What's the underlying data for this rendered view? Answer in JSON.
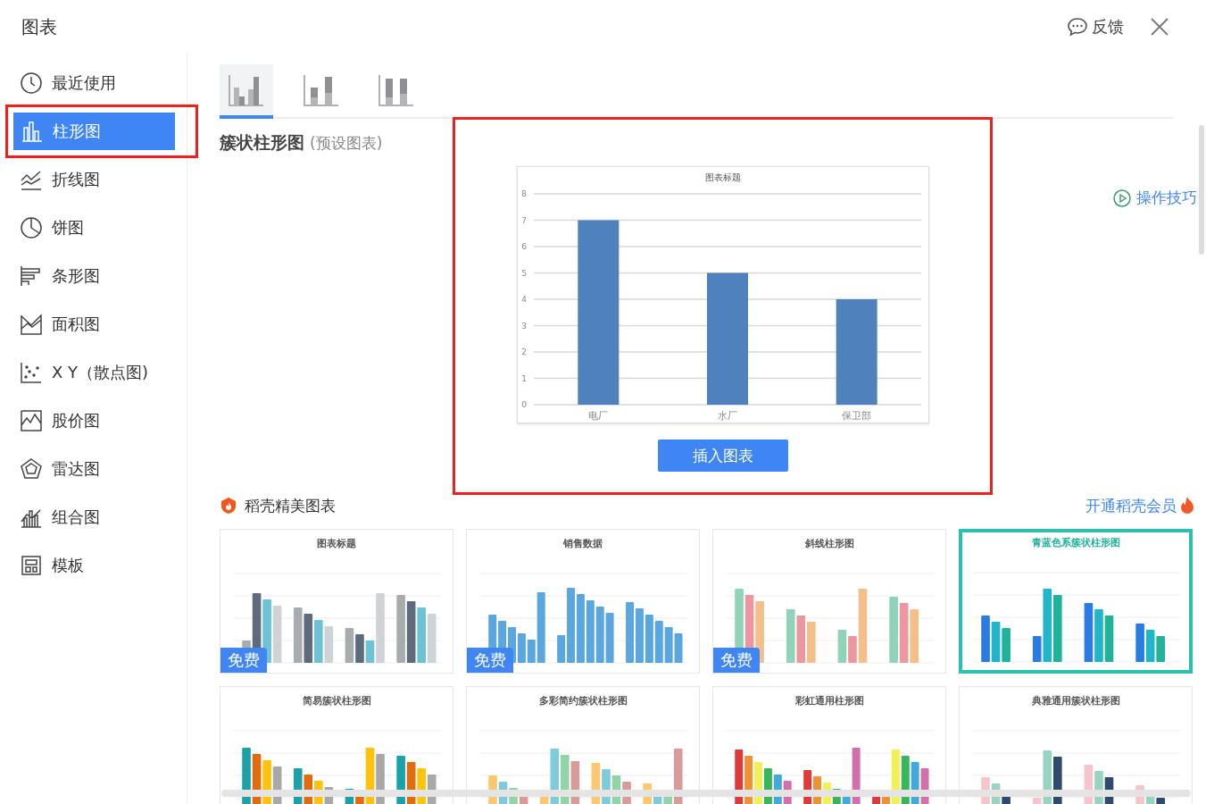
{
  "window": {
    "title": "图表"
  },
  "header": {
    "feedback": "反馈"
  },
  "sidebar": {
    "items": [
      {
        "label": "最近使用",
        "selected": false
      },
      {
        "label": "柱形图",
        "selected": true
      },
      {
        "label": "折线图",
        "selected": false
      },
      {
        "label": "饼图",
        "selected": false
      },
      {
        "label": "条形图",
        "selected": false
      },
      {
        "label": "面积图",
        "selected": false
      },
      {
        "label": "X Y（散点图)",
        "selected": false
      },
      {
        "label": "股价图",
        "selected": false
      },
      {
        "label": "雷达图",
        "selected": false
      },
      {
        "label": "组合图",
        "selected": false
      },
      {
        "label": "模板",
        "selected": false
      }
    ]
  },
  "subtypes": [
    {
      "selected": true
    },
    {
      "selected": false
    },
    {
      "selected": false
    }
  ],
  "heading": {
    "title": "簇状柱形图",
    "note": "(预设图表)"
  },
  "tips_link": "操作技巧",
  "preview": {
    "chart_data": {
      "type": "bar",
      "title": "图表标题",
      "categories": [
        "电厂",
        "水厂",
        "保卫部"
      ],
      "values": [
        7,
        5,
        4
      ],
      "ylim": [
        0,
        8
      ],
      "grid": true,
      "yticks": [
        0,
        1,
        2,
        3,
        4,
        5,
        6,
        7,
        8
      ]
    },
    "insert_button": "插入图表"
  },
  "gallery": {
    "title": "稻壳精美图表",
    "member_link": "开通稻壳会员",
    "cards": [
      {
        "title": "图表标题",
        "badge": "免费"
      },
      {
        "title": "销售数据",
        "badge": "免费"
      },
      {
        "title": "斜线柱形图",
        "badge": "免费"
      },
      {
        "title": "青蓝色系簇状柱形图"
      },
      {
        "title": "简易簇状柱形图"
      },
      {
        "title": "多彩简约簇状柱形图"
      },
      {
        "title": "彩虹通用柱形图"
      },
      {
        "title": "典雅通用簇状柱形图"
      }
    ]
  }
}
